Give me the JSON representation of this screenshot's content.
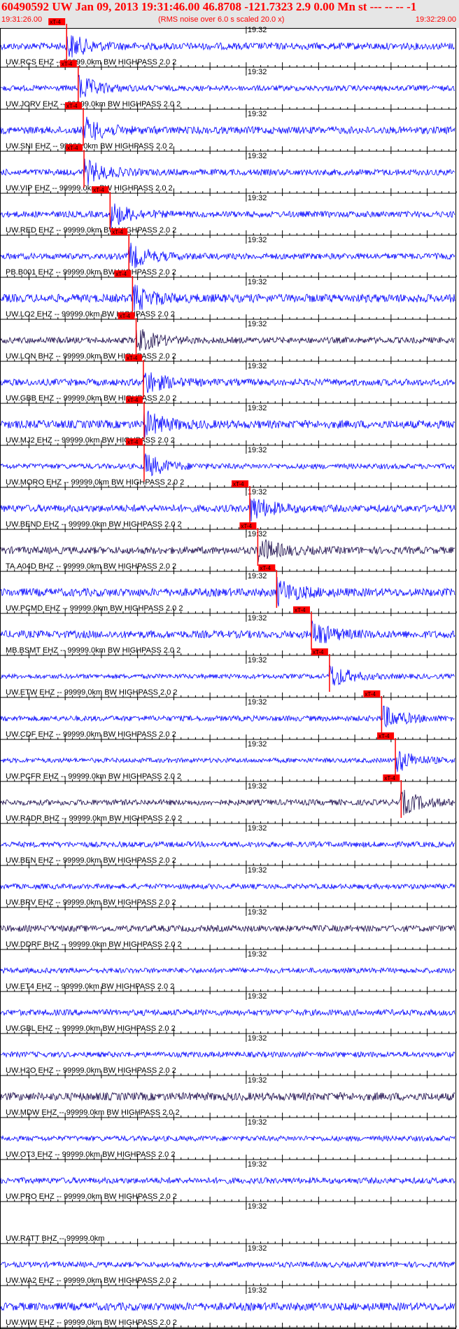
{
  "header": {
    "title": "60490592 UW Jan 09, 2013 19:31:46.00   46.8708 -121.7323  2.9 0.00 Mn st --- -- --  -1",
    "start_time": "19:31:26.00",
    "scale_note": "(RMS noise over 6.0 s scaled 20.0 x)",
    "end_time": "19:32:29.00"
  },
  "colors": {
    "trace": "#0000ff",
    "trace_dark": "#1a0a4a",
    "pick": "#ff0000",
    "axis": "#000000",
    "header_bg": "#e6e6e6"
  },
  "chart_data": {
    "type": "line",
    "title": "60490592 UW Jan 09, 2013 19:31:46.00   46.8708 -121.7323  2.9 0.00 Mn st --- -- --  -1",
    "x_range": [
      "19:31:26.00",
      "19:32:29.00"
    ],
    "minute_tick_label": "19:32",
    "pick_label": "xT-4",
    "panels": [
      {
        "label": "UW.RCS EHZ -- 99999.0km BW  HIGHPASS  2.0  2",
        "pick_s": 9.2,
        "color": "blue"
      },
      {
        "label": "UW.JORV EHZ -- 99999.0km BW  HIGHPASS  2.0  2",
        "pick_s": 10.8,
        "color": "blue"
      },
      {
        "label": "UW.SNI EHZ -- 99999.0km BW  HIGHPASS  2.0  2",
        "pick_s": 11.5,
        "color": "blue"
      },
      {
        "label": "UW.VIP EHZ -- 99999.0km BW  HIGHPASS  2.0  2",
        "pick_s": 11.6,
        "color": "blue"
      },
      {
        "label": "UW.RED EHZ -- 99999.0km BW  HIGHPASS  2.0  2",
        "pick_s": 15.2,
        "color": "blue"
      },
      {
        "label": "PB.B001 EHZ -- 99999.0km BW  HIGHPASS  2.0  2",
        "pick_s": 17.8,
        "color": "blue"
      },
      {
        "label": "UW.LO2 EHZ -- 99999.0km BW  HIGHPASS  2.0  2",
        "pick_s": 18.3,
        "color": "blue"
      },
      {
        "label": "UW.LON BHZ -- 99999.0km BW  HIGHPASS  2.0  2",
        "pick_s": 18.8,
        "color": "dark"
      },
      {
        "label": "UW.GBB EHZ -- 99999.0km BW  HIGHPASS  2.0  2",
        "pick_s": 19.8,
        "color": "blue"
      },
      {
        "label": "UW.MJ2 EHZ -- 99999.0km BW  HIGHPASS  2.0  2",
        "pick_s": 19.9,
        "color": "blue"
      },
      {
        "label": "UW.MORO EHZ -- 99999.0km BW  HIGHPASS  2.0  2",
        "pick_s": 19.9,
        "color": "blue"
      },
      {
        "label": "UW.BEND EHZ -- 99999.0km BW  HIGHPASS  2.0  2",
        "pick_s": 34.5,
        "color": "blue"
      },
      {
        "label": "TA.A04D BHZ -- 99999.0km BW  HIGHPASS  2.0  2",
        "pick_s": 35.6,
        "color": "dark"
      },
      {
        "label": "UW.PCMD EHZ -- 99999.0km BW  HIGHPASS  2.0  2",
        "pick_s": 38.2,
        "color": "blue"
      },
      {
        "label": "MB.BSMT EHZ -- 99999.0km BW  HIGHPASS  2.0  2",
        "pick_s": 43.0,
        "color": "blue"
      },
      {
        "label": "UW.ETW EHZ -- 99999.0km BW  HIGHPASS  2.0  2",
        "pick_s": 45.5,
        "color": "blue"
      },
      {
        "label": "UW.CDF EHZ -- 99999.0km BW  HIGHPASS  2.0  2",
        "pick_s": 52.7,
        "color": "blue"
      },
      {
        "label": "UW.PCFR EHZ -- 99999.0km BW  HIGHPASS  2.0  2",
        "pick_s": 54.6,
        "color": "blue"
      },
      {
        "label": "UW.RADR BHZ -- 99999.0km BW  HIGHPASS  2.0  2",
        "pick_s": 55.4,
        "color": "dark"
      },
      {
        "label": "UW.BEN EHZ -- 99999.0km BW  HIGHPASS  2.0  2",
        "pick_s": null,
        "color": "blue"
      },
      {
        "label": "UW.BRV EHZ -- 99999.0km BW  HIGHPASS  2.0  2",
        "pick_s": null,
        "color": "blue"
      },
      {
        "label": "UW.DDRF BHZ -- 99999.0km BW  HIGHPASS  2.0  2",
        "pick_s": null,
        "color": "dark"
      },
      {
        "label": "UW.ET4 EHZ -- 99999.0km BW  HIGHPASS  2.0  2",
        "pick_s": null,
        "color": "blue"
      },
      {
        "label": "UW.GBL EHZ -- 99999.0km BW  HIGHPASS  2.0  2",
        "pick_s": null,
        "color": "blue"
      },
      {
        "label": "UW.H2O EHZ -- 99999.0km BW  HIGHPASS  2.0  2",
        "pick_s": null,
        "color": "blue"
      },
      {
        "label": "UW.MDW EHZ -- 99999.0km BW  HIGHPASS  2.0  2",
        "pick_s": null,
        "color": "dark"
      },
      {
        "label": "UW.OT3 EHZ -- 99999.0km BW  HIGHPASS  2.0  2",
        "pick_s": null,
        "color": "blue"
      },
      {
        "label": "UW.PRO EHZ -- 99999.0km BW  HIGHPASS  2.0  2",
        "pick_s": null,
        "color": "blue"
      },
      {
        "label": "UW.RATT BHZ -- 99999.0km",
        "pick_s": null,
        "color": "none"
      },
      {
        "label": "UW.WA2 EHZ -- 99999.0km BW  HIGHPASS  2.0  2",
        "pick_s": null,
        "color": "blue"
      },
      {
        "label": "UW.WIW EHZ -- 99999.0km BW  HIGHPASS  2.0  2",
        "pick_s": null,
        "color": "blue"
      }
    ]
  }
}
